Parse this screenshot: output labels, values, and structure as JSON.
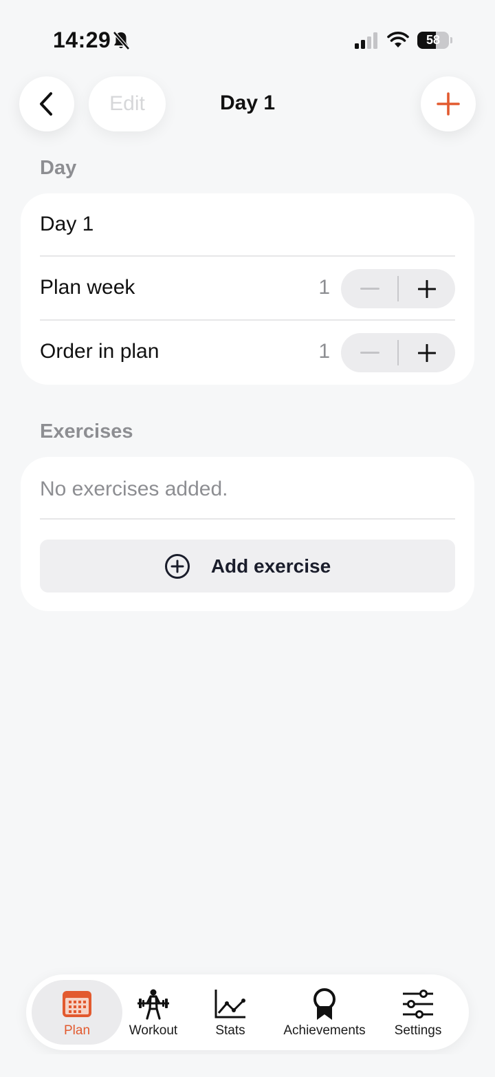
{
  "status_bar": {
    "time": "14:29",
    "battery_level": "58",
    "battery_fraction": 0.58
  },
  "nav": {
    "title": "Day 1",
    "edit_label": "Edit",
    "accent_color": "#e25a2f"
  },
  "day_section": {
    "label": "Day",
    "name_value": "Day 1",
    "rows": [
      {
        "label": "Plan week",
        "value": "1"
      },
      {
        "label": "Order in plan",
        "value": "1"
      }
    ]
  },
  "exercises_section": {
    "label": "Exercises",
    "empty_text": "No exercises added.",
    "add_button_label": "Add exercise"
  },
  "tab_bar": {
    "tabs": [
      {
        "label": "Plan",
        "icon": "calendar-icon",
        "active": true
      },
      {
        "label": "Workout",
        "icon": "weightlifter-icon",
        "active": false
      },
      {
        "label": "Stats",
        "icon": "line-chart-icon",
        "active": false
      },
      {
        "label": "Achievements",
        "icon": "ribbon-award-icon",
        "active": false
      },
      {
        "label": "Settings",
        "icon": "sliders-icon",
        "active": false
      }
    ]
  }
}
